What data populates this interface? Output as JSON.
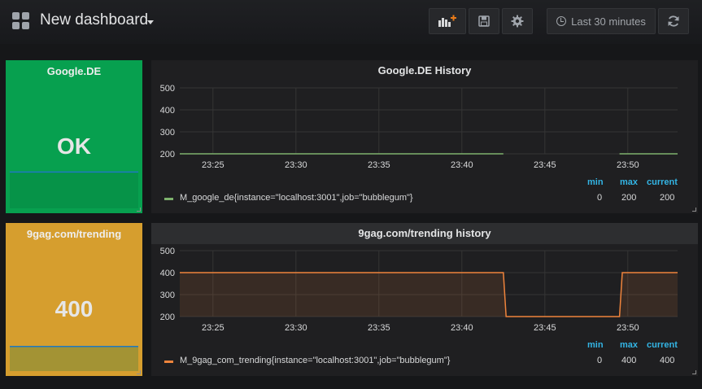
{
  "header": {
    "dashboard_title": "New dashboard",
    "time_range_label": "Last 30 minutes",
    "icons": [
      "dashboard-grid-icon",
      "add-panel-icon",
      "save-icon",
      "settings-gear-icon",
      "clock-icon",
      "refresh-icon"
    ]
  },
  "colors": {
    "ok_green": "#07a04f",
    "warn_orange": "#d69e2e",
    "legend_header": "#33b5e5",
    "series_green": "#7eb26d",
    "series_orange": "#ef843c",
    "sparkline": "#1f78c1"
  },
  "panels": {
    "google_stat": {
      "title": "Google.DE",
      "value": "OK",
      "level": 0.62
    },
    "google_graph": {
      "title": "Google.DE History",
      "legend": {
        "min_label": "min",
        "max_label": "max",
        "current_label": "current",
        "series_name": "M_google_de{instance=\"localhost:3001\",job=\"bubblegum\"}",
        "min": "0",
        "max": "200",
        "current": "200"
      }
    },
    "ninegag_stat": {
      "title": "9gag.com/trending",
      "value": "400",
      "level": 0.42
    },
    "ninegag_graph": {
      "title": "9gag.com/trending history",
      "legend": {
        "min_label": "min",
        "max_label": "max",
        "current_label": "current",
        "series_name": "M_9gag_com_trending{instance=\"localhost:3001\",job=\"bubblegum\"}",
        "min": "0",
        "max": "400",
        "current": "400"
      }
    }
  },
  "chart_data": [
    {
      "type": "line",
      "title": "Google.DE History",
      "xlabel": "",
      "ylabel": "",
      "x_ticks": [
        "23:25",
        "23:30",
        "23:35",
        "23:40",
        "23:45",
        "23:50"
      ],
      "y_ticks": [
        200,
        300,
        400,
        500
      ],
      "ylim": [
        200,
        500
      ],
      "xlim": [
        "23:23",
        "23:53"
      ],
      "grid": true,
      "legend_position": "bottom",
      "series": [
        {
          "name": "M_google_de{instance=\"localhost:3001\",job=\"bubblegum\"}",
          "segments": [
            {
              "x": [
                "23:23",
                "23:42:30"
              ],
              "y": [
                200,
                200
              ]
            },
            {
              "x": [
                "23:49:30",
                "23:53"
              ],
              "y": [
                200,
                200
              ]
            }
          ]
        }
      ]
    },
    {
      "type": "area",
      "title": "9gag.com/trending history",
      "xlabel": "",
      "ylabel": "",
      "x_ticks": [
        "23:25",
        "23:30",
        "23:35",
        "23:40",
        "23:45",
        "23:50"
      ],
      "y_ticks": [
        200,
        300,
        400,
        500
      ],
      "ylim": [
        200,
        500
      ],
      "xlim": [
        "23:23",
        "23:53"
      ],
      "grid": true,
      "legend_position": "bottom",
      "series": [
        {
          "name": "M_9gag_com_trending{instance=\"localhost:3001\",job=\"bubblegum\"}",
          "x": [
            "23:23",
            "23:42:30",
            "23:42:40",
            "23:49:30",
            "23:49:40",
            "23:53"
          ],
          "y": [
            400,
            400,
            200,
            200,
            400,
            400
          ]
        }
      ]
    }
  ]
}
